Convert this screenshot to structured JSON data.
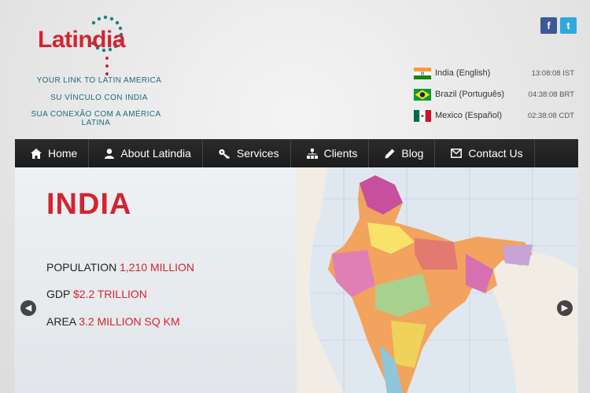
{
  "logo": {
    "name": "Latindia",
    "taglines": [
      "YOUR LINK TO LATIN AMERICA",
      "SU VÍNCULO CON INDIA",
      "SUA CONEXÃO COM A AMÉRICA LATINA"
    ]
  },
  "clocks": [
    {
      "label": "India (English)",
      "time": "13:08:08 IST"
    },
    {
      "label": "Brazil (Português)",
      "time": "04:38:08 BRT"
    },
    {
      "label": "Mexico (Español)",
      "time": "02:38:08 CDT"
    }
  ],
  "nav": [
    {
      "label": "Home",
      "icon": "home-icon"
    },
    {
      "label": "About Latindia",
      "icon": "user-icon"
    },
    {
      "label": "Services",
      "icon": "key-icon"
    },
    {
      "label": "Clients",
      "icon": "org-chart-icon"
    },
    {
      "label": "Blog",
      "icon": "pencil-icon"
    },
    {
      "label": "Contact Us",
      "icon": "envelope-icon"
    }
  ],
  "slide": {
    "title": "INDIA",
    "stats": [
      {
        "label": "POPULATION",
        "value": "1,210 MILLION"
      },
      {
        "label": "GDP",
        "value": "$2.2 TRILLION"
      },
      {
        "label": "AREA",
        "value": "3.2 MILLION SQ KM"
      }
    ],
    "arrow_prev": "◀",
    "arrow_next": "▶"
  },
  "social": {
    "facebook": "f",
    "twitter": "t"
  },
  "colors": {
    "brand_red": "#d32430",
    "tagline_teal": "#1f6a7a",
    "nav_bg": "#222222"
  }
}
